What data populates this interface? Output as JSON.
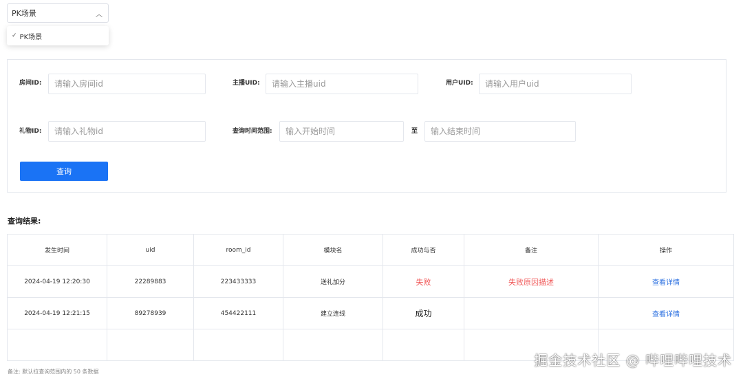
{
  "scene_select": {
    "selected": "PK场景",
    "options": [
      {
        "label": "PK场景",
        "checked": true
      }
    ]
  },
  "filters": {
    "room_id": {
      "label": "房间ID:",
      "placeholder": "请输入房间id"
    },
    "anchor_uid": {
      "label": "主播UID:",
      "placeholder": "请输入主播uid"
    },
    "user_uid": {
      "label": "用户UID:",
      "placeholder": "请输入用户uid"
    },
    "gift_id": {
      "label": "礼物ID:",
      "placeholder": "请输入礼物id"
    },
    "time_range": {
      "label": "查询时间范围:",
      "start_placeholder": "输入开始时间",
      "separator": "至",
      "end_placeholder": "输入结束时间"
    },
    "query_button": "查询"
  },
  "results": {
    "title": "查询结果:",
    "columns": [
      "发生时间",
      "uid",
      "room_id",
      "模块名",
      "成功与否",
      "备注",
      "操作"
    ],
    "rows": [
      {
        "time": "2024-04-19 12:20:30",
        "uid": "22289883",
        "room_id": "223433333",
        "module": "送礼加分",
        "status": "失败",
        "remark": "失败原因描述",
        "action": "查看详情"
      },
      {
        "time": "2024-04-19 12:21:15",
        "uid": "89278939",
        "room_id": "454422111",
        "module": "建立连线",
        "status": "成功",
        "remark": "",
        "action": "查看详情"
      }
    ]
  },
  "footnote": "备注: 默认拉查询范围内的 50 条数据",
  "watermark": "掘金技术社区 @ 哔哩哔哩技术",
  "colors": {
    "primary": "#1a73f5",
    "fail": "#f05656",
    "link": "#2a6fe0"
  }
}
